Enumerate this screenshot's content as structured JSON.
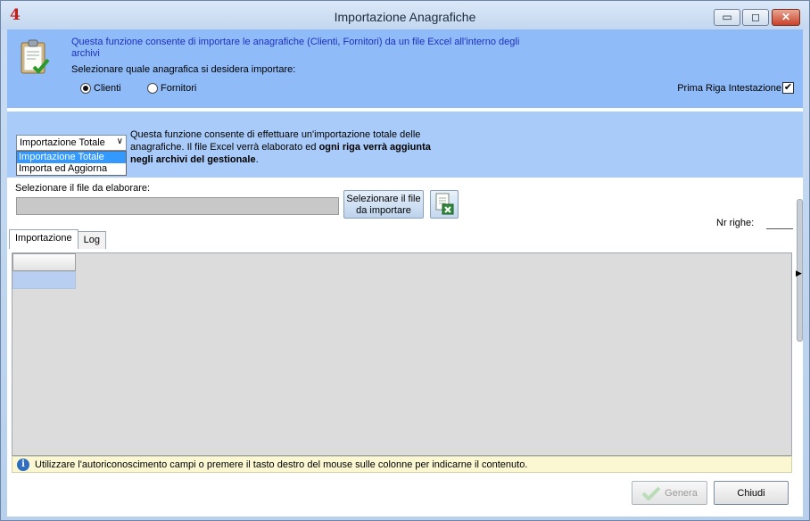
{
  "window": {
    "title": "Importazione Anagrafiche",
    "app_icon_text": "4",
    "minimize_glyph": "▭",
    "maximize_glyph": "◻",
    "close_glyph": "✕"
  },
  "header": {
    "description": "Questa funzione consente di importare le anagrafiche (Clienti, Fornitori) da un file Excel all'interno degli archivi",
    "select_prompt": "Selezionare quale anagrafica si desidera importare:",
    "radio_options": [
      {
        "label": "Clienti",
        "selected": true
      },
      {
        "label": "Fornitori",
        "selected": false
      }
    ],
    "first_row_header_label": "Prima Riga Intestazione",
    "first_row_header_checked": true
  },
  "import_mode": {
    "selected": "Importazione Totale",
    "options": [
      "Importazione Totale",
      "Importa ed Aggiorna"
    ],
    "desc_part1": "Questa funzione consente di effettuare un'importazione totale delle anagrafiche. Il file Excel verrà elaborato ed ",
    "desc_bold": "ogni riga verrà aggiunta negli archivi del gestionale",
    "desc_part2": "."
  },
  "file": {
    "label": "Selezionare il file da elaborare:",
    "value": "",
    "select_button": "Selezionare il file da importare",
    "rows_label": "Nr righe:"
  },
  "tabs": [
    {
      "label": "Importazione",
      "active": true
    },
    {
      "label": "Log",
      "active": false
    }
  ],
  "info": {
    "icon": "info-icon",
    "text": "Utilizzare l'autoriconoscimento campi o premere il tasto destro del mouse sulle colonne per indicarne il contenuto."
  },
  "buttons": {
    "genera": "Genera",
    "chiudi": "Chiudi"
  },
  "colors": {
    "header_panel": "#8fbbf8",
    "mode_panel": "#a9cbf9",
    "description_text": "#1d2fbd",
    "info_bar": "#fbf7d2"
  }
}
